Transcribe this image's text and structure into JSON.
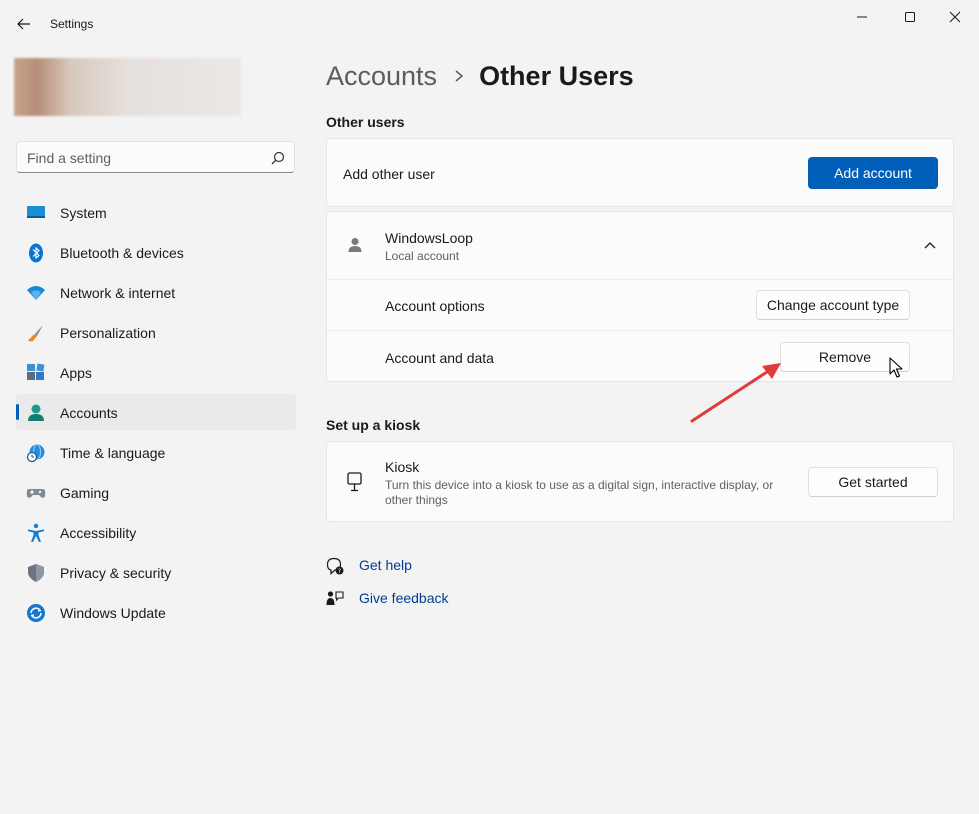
{
  "window": {
    "title": "Settings",
    "back_icon": "back-arrow-icon",
    "controls": [
      "minimize-icon",
      "maximize-icon",
      "close-icon"
    ]
  },
  "search": {
    "placeholder": "Find a setting",
    "value": ""
  },
  "sidebar": {
    "items": [
      {
        "label": "System",
        "icon": "system-monitor-icon",
        "active": false
      },
      {
        "label": "Bluetooth & devices",
        "icon": "bluetooth-icon",
        "active": false
      },
      {
        "label": "Network & internet",
        "icon": "wifi-icon",
        "active": false
      },
      {
        "label": "Personalization",
        "icon": "paintbrush-icon",
        "active": false
      },
      {
        "label": "Apps",
        "icon": "apps-icon",
        "active": false
      },
      {
        "label": "Accounts",
        "icon": "accounts-icon",
        "active": true
      },
      {
        "label": "Time & language",
        "icon": "globe-clock-icon",
        "active": false
      },
      {
        "label": "Gaming",
        "icon": "gamepad-icon",
        "active": false
      },
      {
        "label": "Accessibility",
        "icon": "accessibility-icon",
        "active": false
      },
      {
        "label": "Privacy & security",
        "icon": "shield-icon",
        "active": false
      },
      {
        "label": "Windows Update",
        "icon": "update-icon",
        "active": false
      }
    ]
  },
  "breadcrumb": {
    "parent": "Accounts",
    "current": "Other Users"
  },
  "other_users": {
    "section_title": "Other users",
    "add_label": "Add other user",
    "add_button": "Add account",
    "user": {
      "name": "WindowsLoop",
      "type": "Local account",
      "options_label": "Account options",
      "options_button": "Change account type",
      "data_label": "Account and data",
      "data_button": "Remove"
    }
  },
  "kiosk": {
    "section_title": "Set up a kiosk",
    "title": "Kiosk",
    "description_line1": "Turn this device into a kiosk to use as a digital sign, interactive display, or",
    "description_line2": "other things",
    "button": "Get started"
  },
  "links": {
    "help": "Get help",
    "feedback": "Give feedback"
  },
  "colors": {
    "accent": "#005fb8",
    "link": "#003e92",
    "annotation_arrow": "#e03a3a"
  }
}
